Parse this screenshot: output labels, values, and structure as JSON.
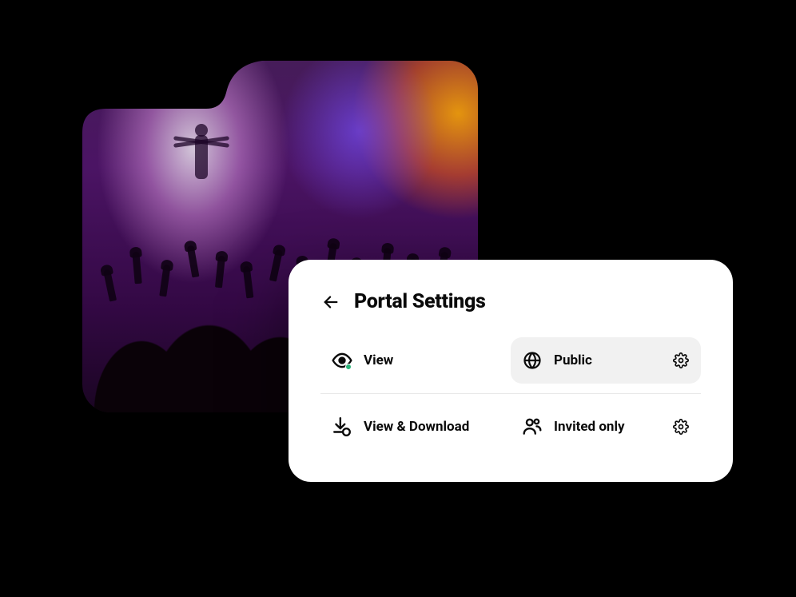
{
  "card": {
    "title": "Portal Settings"
  },
  "settings": {
    "row1": {
      "left": {
        "label": "View"
      },
      "right": {
        "label": "Public",
        "selected": true
      }
    },
    "row2": {
      "left": {
        "label": "View & Download"
      },
      "right": {
        "label": "Invited only"
      }
    }
  },
  "colors": {
    "accent_green": "#2bb57a",
    "selected_bg": "#f1f1f1"
  }
}
